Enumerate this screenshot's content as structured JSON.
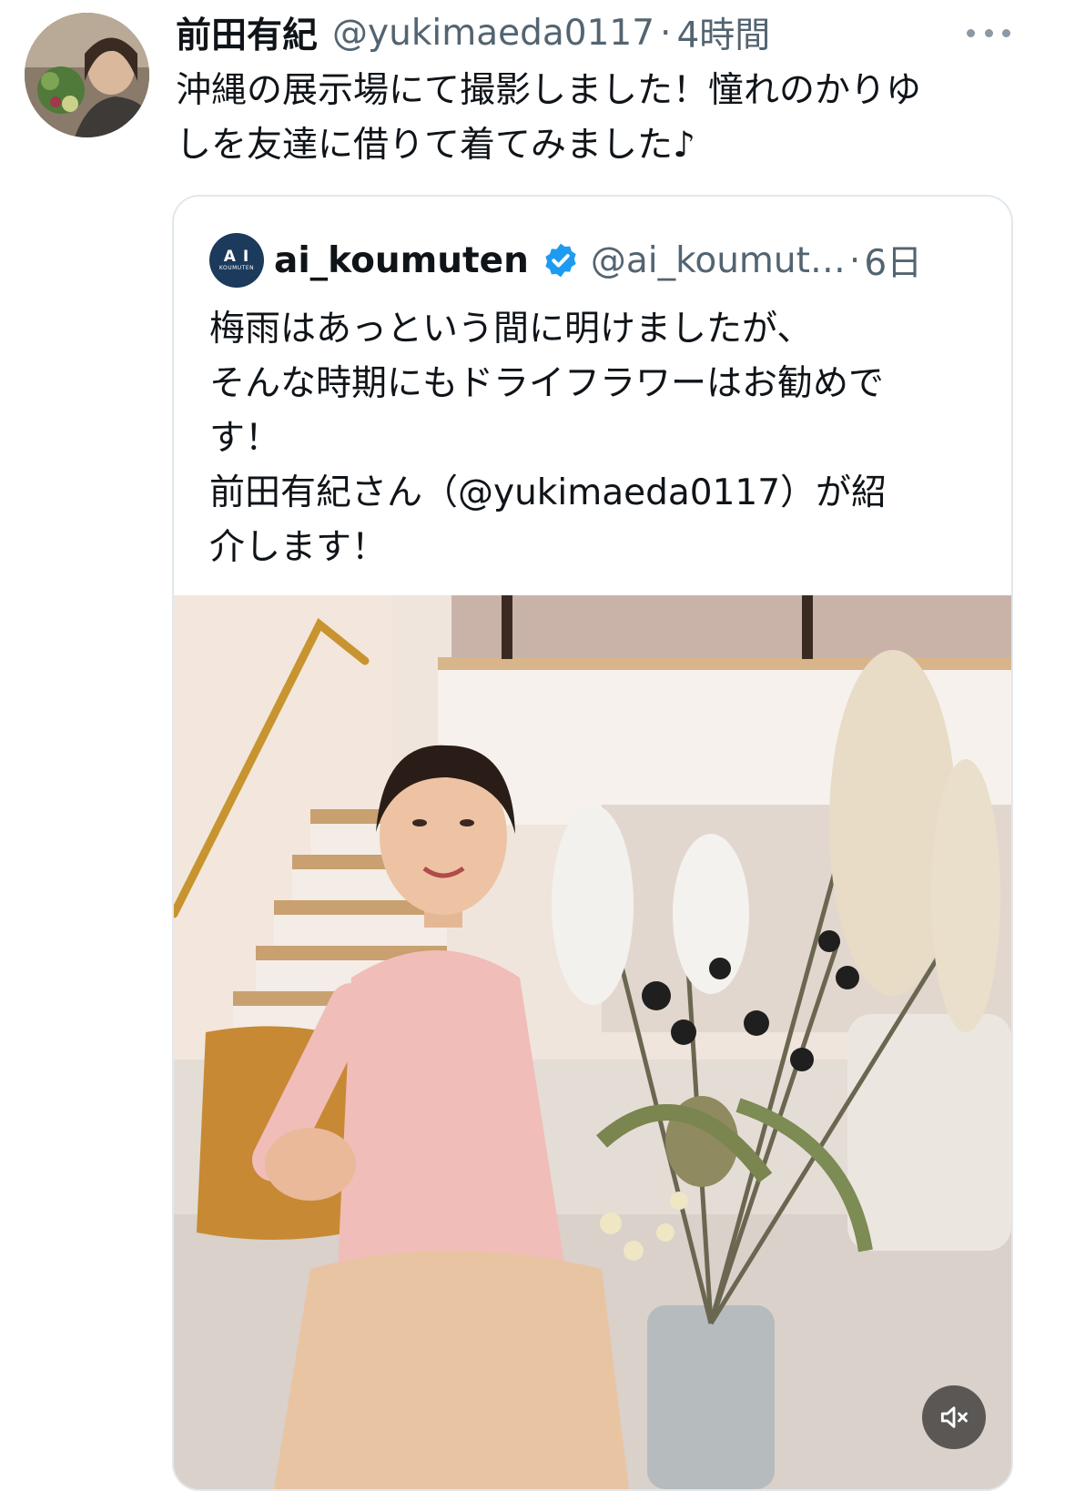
{
  "tweet": {
    "display_name": "前田有紀",
    "handle": "@yukimaeda0117",
    "separator": "·",
    "time": "4時間",
    "text": "沖縄の展示場にて撮影しました！憧れのかりゆ\nしを友達に借りて着てみました♪"
  },
  "quoted_tweet": {
    "avatar_logo": "A I",
    "avatar_logo_sub": "KOUMUTEN",
    "display_name": "ai_koumuten",
    "verified": true,
    "handle": "@ai_koumut…",
    "separator": "·",
    "time": "6日",
    "text": "梅雨はあっという間に明けましたが、\nそんな時期にもドライフラワーはお勧めで\nす！\n前田有紀さん（@yukimaeda0117）が紹\n介します！"
  },
  "icons": {
    "more": "more-horizontal-icon",
    "verified": "verified-badge-icon",
    "mute": "volume-muted-icon"
  },
  "colors": {
    "text": "#0f1419",
    "secondary": "#536471",
    "verified": "#1d9bf0",
    "border": "#e1e8ed"
  }
}
